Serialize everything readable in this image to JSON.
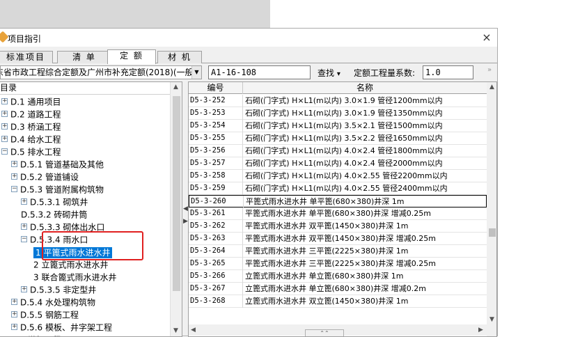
{
  "window": {
    "title": "项目指引",
    "close_glyph": "×"
  },
  "tabs": [
    "标准项目",
    "清 单",
    "定 额",
    "材 机"
  ],
  "active_tab": 2,
  "toolbar": {
    "quota_library": "东省市政工程综合定额及广州市补充定额(2018)(一般",
    "code_value": "A1-16-108",
    "find_label": "查找",
    "find_arrow": "▾",
    "coef_label": "定额工程量系数:",
    "coef_value": "1.0",
    "more_glyph": "»"
  },
  "tree": {
    "header": "目录",
    "items": [
      {
        "label": "D.1 通用项目",
        "expander": "+"
      },
      {
        "label": "D.2 道路工程",
        "expander": "+"
      },
      {
        "label": "D.3 桥涵工程",
        "expander": "+"
      },
      {
        "label": "D.4 给水工程",
        "expander": "+"
      },
      {
        "label": "D.5 排水工程",
        "expander": "−"
      },
      {
        "label": "D.5.1 管道基础及其他",
        "expander": "+"
      },
      {
        "label": "D.5.2 管道铺设",
        "expander": "+"
      },
      {
        "label": "D.5.3 管道附属构筑物",
        "expander": "−"
      },
      {
        "label": "D.5.3.1 砌筑井",
        "expander": "+"
      },
      {
        "label": "D.5.3.2 砖砌井筒",
        "expander": ""
      },
      {
        "label": "D.5.3.3 砌体出水口",
        "expander": "+"
      },
      {
        "label": "D.5.3.4 雨水口",
        "expander": "−"
      },
      {
        "label": "1 平篦式雨水进水井",
        "expander": ""
      },
      {
        "label": "2 立篦式雨水进水井",
        "expander": ""
      },
      {
        "label": "3 联合篦式雨水进水井",
        "expander": ""
      },
      {
        "label": "D.5.3.5 非定型井",
        "expander": "+"
      },
      {
        "label": "D.5.4 水处理构筑物",
        "expander": "+"
      },
      {
        "label": "D.5.5 钢筋工程",
        "expander": "+"
      },
      {
        "label": "D.5.6 模板、井字架工程",
        "expander": "+"
      },
      {
        "label": "D.6 燃气工程",
        "expander": "+"
      }
    ]
  },
  "grid": {
    "columns": [
      "编号",
      "名称"
    ],
    "rows": [
      {
        "code": "D5-3-252",
        "name": "石砌(门字式) H×L1(m以内) 3.0×1.9 管径1200mm以内"
      },
      {
        "code": "D5-3-253",
        "name": "石砌(门字式) H×L1(m以内) 3.0×1.9 管径1350mm以内"
      },
      {
        "code": "D5-3-254",
        "name": "石砌(门字式) H×L1(m以内) 3.5×2.1 管径1500mm以内"
      },
      {
        "code": "D5-3-255",
        "name": "石砌(门字式) H×L1(m以内) 3.5×2.2 管径1650mm以内"
      },
      {
        "code": "D5-3-256",
        "name": "石砌(门字式) H×L1(m以内) 4.0×2.4 管径1800mm以内"
      },
      {
        "code": "D5-3-257",
        "name": "石砌(门字式) H×L1(m以内) 4.0×2.4 管径2000mm以内"
      },
      {
        "code": "D5-3-258",
        "name": "石砌(门字式) H×L1(m以内) 4.0×2.55 管径2200mm以内"
      },
      {
        "code": "D5-3-259",
        "name": "石砌(门字式) H×L1(m以内) 4.0×2.55 管径2400mm以内"
      },
      {
        "code": "D5-3-260",
        "name": "平篦式雨水进水井 单平篦(680×380)井深 1m"
      },
      {
        "code": "D5-3-261",
        "name": "平篦式雨水进水井 单平篦(680×380)井深 增减0.25m"
      },
      {
        "code": "D5-3-262",
        "name": "平篦式雨水进水井 双平篦(1450×380)井深 1m"
      },
      {
        "code": "D5-3-263",
        "name": "平篦式雨水进水井 双平篦(1450×380)井深 增减0.25m"
      },
      {
        "code": "D5-3-264",
        "name": "平篦式雨水进水井 三平篦(2225×380)井深 1m"
      },
      {
        "code": "D5-3-265",
        "name": "平篦式雨水进水井 三平篦(2225×380)井深 增减0.25m"
      },
      {
        "code": "D5-3-266",
        "name": "立篦式雨水进水井 单立篦(680×380)井深 1m"
      },
      {
        "code": "D5-3-267",
        "name": "立篦式雨水进水井 单立篦(680×380)井深 增减0.2m"
      },
      {
        "code": "D5-3-268",
        "name": "立篦式雨水进水井 双立篦(1450×380)井深 1m"
      }
    ]
  },
  "scroll_glyphs": {
    "up": "▲",
    "down": "▼",
    "left": "◀",
    "right": "▶",
    "split_left": "◀",
    "split_right": "▶",
    "grip": "⌃⌃"
  },
  "colors": {
    "selection": "#0078d7",
    "highlight_box": "#e02020",
    "title_icon": "#e8a23a"
  }
}
